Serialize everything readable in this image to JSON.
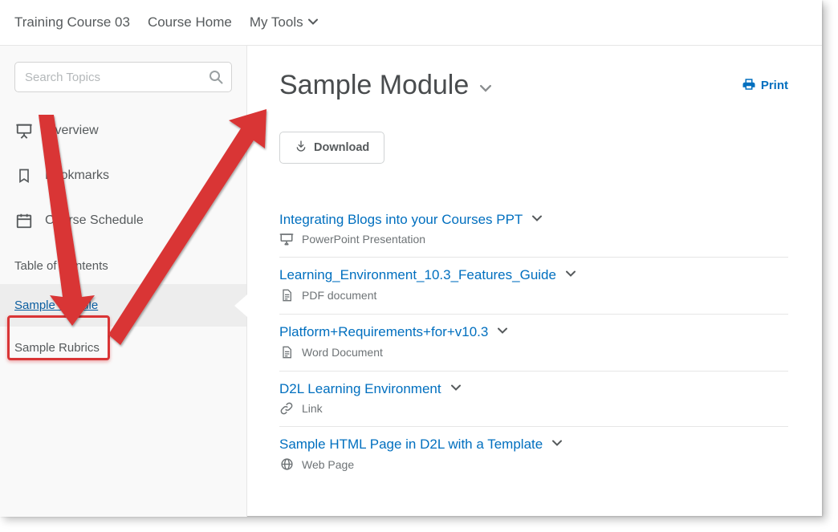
{
  "nav": {
    "course_title": "Training Course 03",
    "course_home": "Course Home",
    "my_tools": "My Tools"
  },
  "sidebar": {
    "search_placeholder": "Search Topics",
    "overview": "Overview",
    "bookmarks": "Bookmarks",
    "schedule": "Course Schedule",
    "toc_header": "Table of Contents",
    "modules": [
      {
        "label": "Sample Module",
        "active": true
      },
      {
        "label": "Sample Rubrics",
        "active": false
      }
    ]
  },
  "main": {
    "title": "Sample Module",
    "print": "Print",
    "download": "Download",
    "items": [
      {
        "title": "Integrating Blogs into your Courses PPT",
        "kind": "PowerPoint Presentation",
        "icon": "ppt"
      },
      {
        "title": "Learning_Environment_10.3_Features_Guide",
        "kind": "PDF document",
        "icon": "doc"
      },
      {
        "title": "Platform+Requirements+for+v10.3",
        "kind": "Word Document",
        "icon": "doc"
      },
      {
        "title": "D2L Learning Environment",
        "kind": "Link",
        "icon": "link"
      },
      {
        "title": "Sample HTML Page in D2L with a Template",
        "kind": "Web Page",
        "icon": "web"
      }
    ]
  }
}
